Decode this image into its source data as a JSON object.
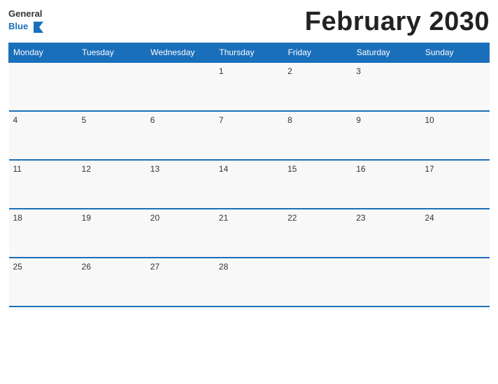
{
  "header": {
    "logo_general": "General",
    "logo_blue": "Blue",
    "month_title": "February 2030"
  },
  "calendar": {
    "days_of_week": [
      "Monday",
      "Tuesday",
      "Wednesday",
      "Thursday",
      "Friday",
      "Saturday",
      "Sunday"
    ],
    "weeks": [
      [
        "",
        "",
        "",
        "1",
        "2",
        "3",
        ""
      ],
      [
        "4",
        "5",
        "6",
        "7",
        "8",
        "9",
        "10"
      ],
      [
        "11",
        "12",
        "13",
        "14",
        "15",
        "16",
        "17"
      ],
      [
        "18",
        "19",
        "20",
        "21",
        "22",
        "23",
        "24"
      ],
      [
        "25",
        "26",
        "27",
        "28",
        "",
        "",
        ""
      ]
    ]
  }
}
